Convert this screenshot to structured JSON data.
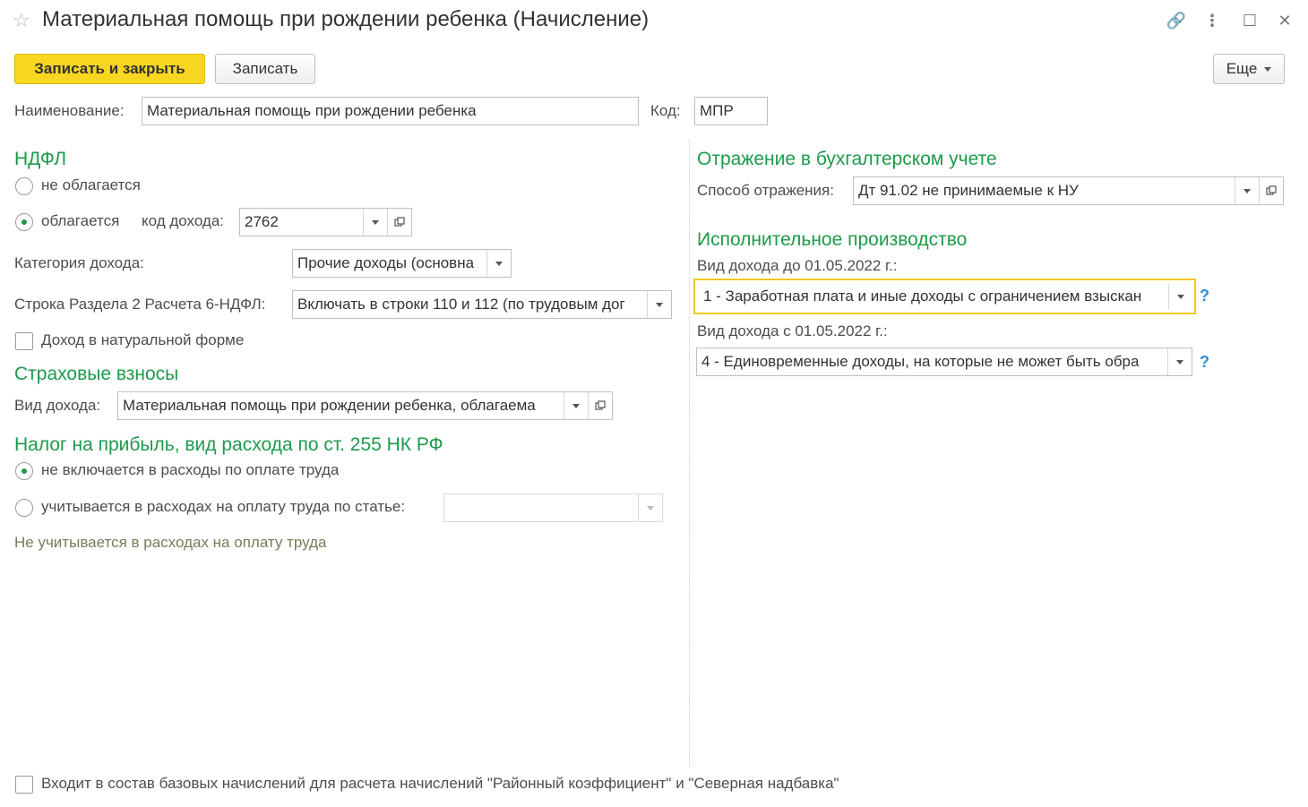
{
  "window": {
    "title": "Материальная помощь при рождении ребенка (Начисление)"
  },
  "toolbar": {
    "save_close": "Записать и закрыть",
    "save": "Записать",
    "more": "Еще"
  },
  "name_row": {
    "name_label": "Наименование:",
    "name_value": "Материальная помощь при рождении ребенка",
    "code_label": "Код:",
    "code_value": "МПР"
  },
  "ndfl": {
    "header": "НДФЛ",
    "not_taxed": "не облагается",
    "taxed": "облагается",
    "income_code_label": "код дохода:",
    "income_code_value": "2762",
    "category_label": "Категория дохода:",
    "category_value": "Прочие доходы (основна",
    "line_label": "Строка Раздела 2 Расчета 6-НДФЛ:",
    "line_value": "Включать в строки 110 и 112 (по трудовым дог",
    "in_kind": "Доход в натуральной форме"
  },
  "insurance": {
    "header": "Страховые взносы",
    "income_type_label": "Вид дохода:",
    "income_type_value": "Материальная помощь при рождении ребенка, облагаема"
  },
  "profit_tax": {
    "header": "Налог на прибыль, вид расхода по ст. 255 НК РФ",
    "not_included": "не включается в расходы по оплате труда",
    "included": "учитывается в расходах на оплату труда по статье:",
    "article_value": "",
    "hint": "Не учитывается в расходах на оплату труда"
  },
  "accounting": {
    "header": "Отражение в бухгалтерском учете",
    "method_label": "Способ отражения:",
    "method_value": "Дт 91.02 не принимаемые к НУ"
  },
  "enforcement": {
    "header": "Исполнительное производство",
    "before_label": "Вид дохода до 01.05.2022 г.:",
    "before_value": "1 - Заработная плата и иные доходы с ограничением взыскан",
    "after_label": "Вид дохода с 01.05.2022 г.:",
    "after_value": "4 - Единовременные доходы, на которые не может быть обра",
    "help": "?"
  },
  "footer": {
    "base_checkbox": "Входит в состав базовых начислений для расчета начислений \"Районный коэффициент\" и \"Северная надбавка\""
  },
  "colors": {
    "accent_green": "#1c9b4a",
    "primary_yellow": "#f7d61f",
    "focus_yellow": "#f0c820",
    "help_blue": "#2b8fd6"
  }
}
